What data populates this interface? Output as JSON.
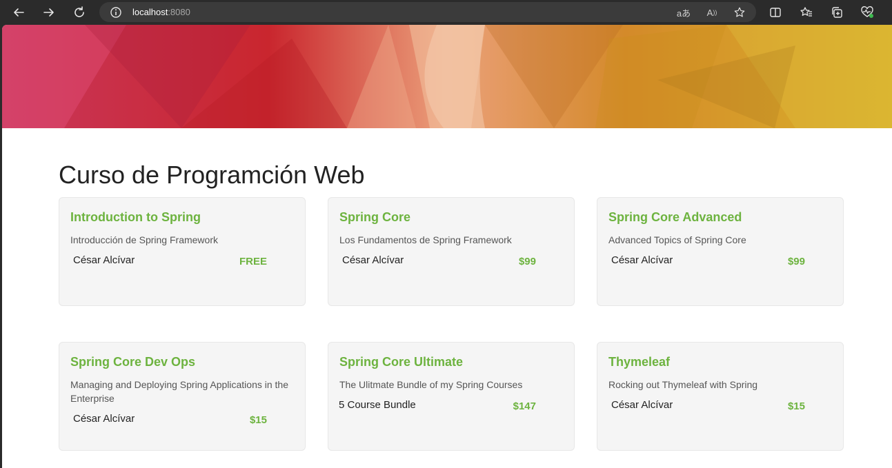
{
  "browser": {
    "url_host": "localhost",
    "url_port": ":8080",
    "icons": [
      "back-icon",
      "forward-icon",
      "refresh-icon",
      "site-info-icon",
      "translate-icon",
      "read-aloud-icon",
      "favorite-star-icon",
      "split-screen-icon",
      "favorites-icon",
      "collections-icon",
      "browser-essentials-icon"
    ],
    "read_aloud_glyph": "A",
    "translate_glyph": "aあ"
  },
  "page": {
    "title": "Curso de Programción Web"
  },
  "colors": {
    "accent_green": "#6db33f",
    "card_bg": "#f5f5f5"
  },
  "courses": [
    {
      "title": "Introduction to Spring",
      "description": "Introducción de Spring Framework",
      "author": "César Alcívar",
      "price": "FREE"
    },
    {
      "title": "Spring Core",
      "description": "Los Fundamentos de Spring Framework",
      "author": "César Alcívar",
      "price": "$99"
    },
    {
      "title": "Spring Core Advanced",
      "description": "Advanced Topics of Spring Core",
      "author": "César Alcívar",
      "price": "$99"
    },
    {
      "title": "Spring Core Dev Ops",
      "description": "Managing and Deploying Spring Applications in the Enterprise",
      "author": "César Alcívar",
      "price": "$15"
    },
    {
      "title": "Spring Core Ultimate",
      "description": "The Ulitmate Bundle of my Spring Courses",
      "author": "5 Course Bundle",
      "price": "$147"
    },
    {
      "title": "Thymeleaf",
      "description": "Rocking out Thymeleaf with Spring",
      "author": "César Alcívar",
      "price": "$15"
    }
  ]
}
